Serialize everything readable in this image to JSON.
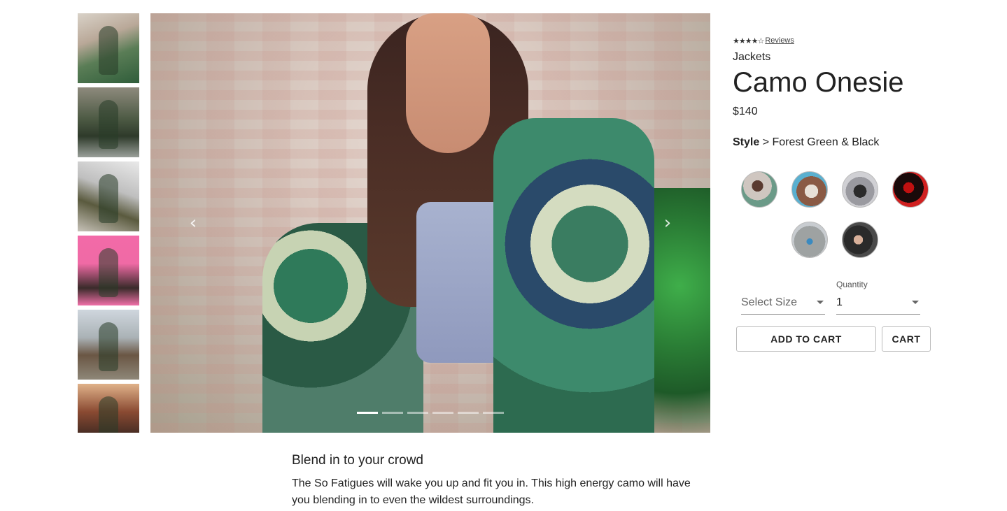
{
  "gallery": {
    "thumbnails": [
      "thumb-1",
      "thumb-2",
      "thumb-3",
      "thumb-4",
      "thumb-5",
      "thumb-6"
    ],
    "indicator_count": 6,
    "active_indicator": 0,
    "prev_glyph": "‹",
    "next_glyph": "›"
  },
  "product": {
    "stars": "★★★★☆",
    "reviews_link": "Reviews",
    "category": "Jackets",
    "title": "Camo Onesie",
    "price": "$140",
    "style_label": "Style",
    "style_separator": " > ",
    "style_value": "Forest Green & Black"
  },
  "selectors": {
    "size_placeholder": "Select Size",
    "quantity_label": "Quantity",
    "quantity_value": "1"
  },
  "actions": {
    "add_to_cart": "ADD TO CART",
    "cart": "CART"
  },
  "description": {
    "heading": "Blend in to your crowd",
    "body": "The So Fatigues will wake you up and fit you in. This high energy camo will have you blending in to even the wildest surroundings."
  }
}
